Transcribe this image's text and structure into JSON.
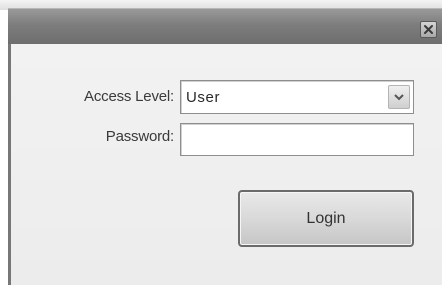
{
  "dialog": {
    "close_icon": "close-icon"
  },
  "form": {
    "access_level_label": "Access Level:",
    "access_level_value": "User",
    "access_level_arrow_icon": "chevron-down-icon",
    "password_label": "Password:",
    "password_value": "",
    "login_label": "Login"
  }
}
